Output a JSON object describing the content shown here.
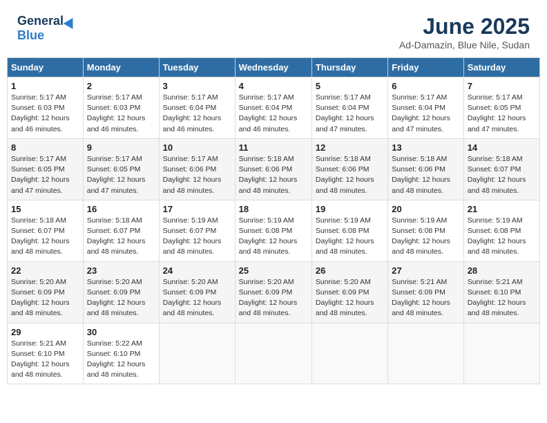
{
  "header": {
    "logo_general": "General",
    "logo_blue": "Blue",
    "month_title": "June 2025",
    "subtitle": "Ad-Damazin, Blue Nile, Sudan"
  },
  "days_of_week": [
    "Sunday",
    "Monday",
    "Tuesday",
    "Wednesday",
    "Thursday",
    "Friday",
    "Saturday"
  ],
  "weeks": [
    [
      {
        "day": "1",
        "sunrise": "5:17 AM",
        "sunset": "6:03 PM",
        "daylight": "12 hours and 46 minutes."
      },
      {
        "day": "2",
        "sunrise": "5:17 AM",
        "sunset": "6:03 PM",
        "daylight": "12 hours and 46 minutes."
      },
      {
        "day": "3",
        "sunrise": "5:17 AM",
        "sunset": "6:04 PM",
        "daylight": "12 hours and 46 minutes."
      },
      {
        "day": "4",
        "sunrise": "5:17 AM",
        "sunset": "6:04 PM",
        "daylight": "12 hours and 46 minutes."
      },
      {
        "day": "5",
        "sunrise": "5:17 AM",
        "sunset": "6:04 PM",
        "daylight": "12 hours and 47 minutes."
      },
      {
        "day": "6",
        "sunrise": "5:17 AM",
        "sunset": "6:04 PM",
        "daylight": "12 hours and 47 minutes."
      },
      {
        "day": "7",
        "sunrise": "5:17 AM",
        "sunset": "6:05 PM",
        "daylight": "12 hours and 47 minutes."
      }
    ],
    [
      {
        "day": "8",
        "sunrise": "5:17 AM",
        "sunset": "6:05 PM",
        "daylight": "12 hours and 47 minutes."
      },
      {
        "day": "9",
        "sunrise": "5:17 AM",
        "sunset": "6:05 PM",
        "daylight": "12 hours and 47 minutes."
      },
      {
        "day": "10",
        "sunrise": "5:17 AM",
        "sunset": "6:06 PM",
        "daylight": "12 hours and 48 minutes."
      },
      {
        "day": "11",
        "sunrise": "5:18 AM",
        "sunset": "6:06 PM",
        "daylight": "12 hours and 48 minutes."
      },
      {
        "day": "12",
        "sunrise": "5:18 AM",
        "sunset": "6:06 PM",
        "daylight": "12 hours and 48 minutes."
      },
      {
        "day": "13",
        "sunrise": "5:18 AM",
        "sunset": "6:06 PM",
        "daylight": "12 hours and 48 minutes."
      },
      {
        "day": "14",
        "sunrise": "5:18 AM",
        "sunset": "6:07 PM",
        "daylight": "12 hours and 48 minutes."
      }
    ],
    [
      {
        "day": "15",
        "sunrise": "5:18 AM",
        "sunset": "6:07 PM",
        "daylight": "12 hours and 48 minutes."
      },
      {
        "day": "16",
        "sunrise": "5:18 AM",
        "sunset": "6:07 PM",
        "daylight": "12 hours and 48 minutes."
      },
      {
        "day": "17",
        "sunrise": "5:19 AM",
        "sunset": "6:07 PM",
        "daylight": "12 hours and 48 minutes."
      },
      {
        "day": "18",
        "sunrise": "5:19 AM",
        "sunset": "6:08 PM",
        "daylight": "12 hours and 48 minutes."
      },
      {
        "day": "19",
        "sunrise": "5:19 AM",
        "sunset": "6:08 PM",
        "daylight": "12 hours and 48 minutes."
      },
      {
        "day": "20",
        "sunrise": "5:19 AM",
        "sunset": "6:08 PM",
        "daylight": "12 hours and 48 minutes."
      },
      {
        "day": "21",
        "sunrise": "5:19 AM",
        "sunset": "6:08 PM",
        "daylight": "12 hours and 48 minutes."
      }
    ],
    [
      {
        "day": "22",
        "sunrise": "5:20 AM",
        "sunset": "6:09 PM",
        "daylight": "12 hours and 48 minutes."
      },
      {
        "day": "23",
        "sunrise": "5:20 AM",
        "sunset": "6:09 PM",
        "daylight": "12 hours and 48 minutes."
      },
      {
        "day": "24",
        "sunrise": "5:20 AM",
        "sunset": "6:09 PM",
        "daylight": "12 hours and 48 minutes."
      },
      {
        "day": "25",
        "sunrise": "5:20 AM",
        "sunset": "6:09 PM",
        "daylight": "12 hours and 48 minutes."
      },
      {
        "day": "26",
        "sunrise": "5:20 AM",
        "sunset": "6:09 PM",
        "daylight": "12 hours and 48 minutes."
      },
      {
        "day": "27",
        "sunrise": "5:21 AM",
        "sunset": "6:09 PM",
        "daylight": "12 hours and 48 minutes."
      },
      {
        "day": "28",
        "sunrise": "5:21 AM",
        "sunset": "6:10 PM",
        "daylight": "12 hours and 48 minutes."
      }
    ],
    [
      {
        "day": "29",
        "sunrise": "5:21 AM",
        "sunset": "6:10 PM",
        "daylight": "12 hours and 48 minutes."
      },
      {
        "day": "30",
        "sunrise": "5:22 AM",
        "sunset": "6:10 PM",
        "daylight": "12 hours and 48 minutes."
      },
      null,
      null,
      null,
      null,
      null
    ]
  ],
  "labels": {
    "sunrise_prefix": "Sunrise: ",
    "sunset_prefix": "Sunset: ",
    "daylight_prefix": "Daylight: "
  }
}
